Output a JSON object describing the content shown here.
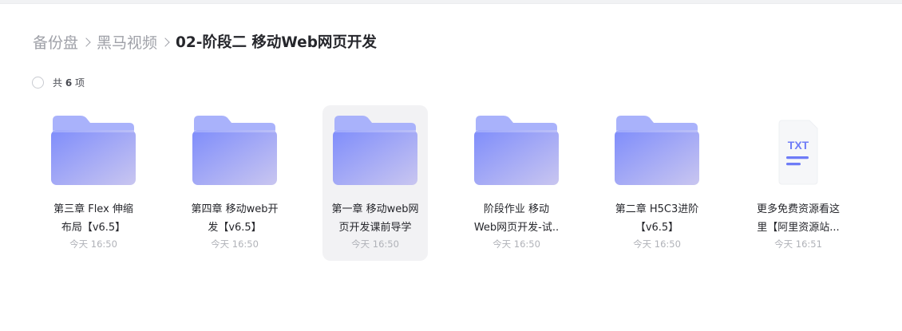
{
  "breadcrumb": {
    "items": [
      "备份盘",
      "黑马视频"
    ],
    "current": "02-阶段二 移动Web网页开发"
  },
  "summary": {
    "prefix": "共",
    "count": "6",
    "suffix": "项"
  },
  "files": [
    {
      "type": "folder",
      "name_lines": [
        "第三章 Flex 伸缩",
        "布局【v6.5】"
      ],
      "time": "今天 16:50"
    },
    {
      "type": "folder",
      "name_lines": [
        "第四章 移动web开",
        "发【v6.5】"
      ],
      "time": "今天 16:50"
    },
    {
      "type": "folder",
      "name_lines": [
        "第一章 移动web网",
        "页开发课前导学"
      ],
      "time": "今天 16:50",
      "hovered": true
    },
    {
      "type": "folder",
      "name_lines": [
        "阶段作业 移动",
        "Web网页开发-试.."
      ],
      "time": "今天 16:50"
    },
    {
      "type": "folder",
      "name_lines": [
        "第二章 H5C3进阶",
        "【v6.5】"
      ],
      "time": "今天 16:50"
    },
    {
      "type": "txt",
      "badge": "TXT",
      "name_lines": [
        "更多免费资源看这",
        "里【阿里资源站..."
      ],
      "time": "今天 16:51"
    }
  ],
  "colors": {
    "folder_back": "#a9b2fb",
    "folder_front_start": "#7f8dfb",
    "folder_front_end": "#c9c6f0",
    "txt_accent": "#6e7cf7"
  }
}
